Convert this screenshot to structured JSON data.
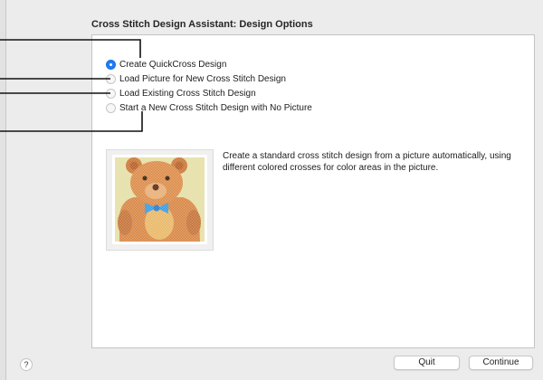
{
  "dialog": {
    "title": "Cross Stitch Design Assistant: Design Options"
  },
  "options": [
    {
      "label": "Create QuickCross Design",
      "selected": true
    },
    {
      "label": "Load Picture for New Cross Stitch Design",
      "selected": false
    },
    {
      "label": "Load Existing Cross Stitch Design",
      "selected": false
    },
    {
      "label": "Start a New Cross Stitch Design with No Picture",
      "selected": false
    }
  ],
  "preview": {
    "image": "teddy-bear-cross-stitch-picture",
    "description": "Create a standard cross stitch design from a picture automatically, using different colored crosses for color areas in the picture."
  },
  "footer": {
    "help_label": "?",
    "quit_label": "Quit",
    "continue_label": "Continue"
  },
  "colors": {
    "accent": "#1f7cf6",
    "window_bg": "#ececec",
    "panel_bg": "#ffffff"
  }
}
